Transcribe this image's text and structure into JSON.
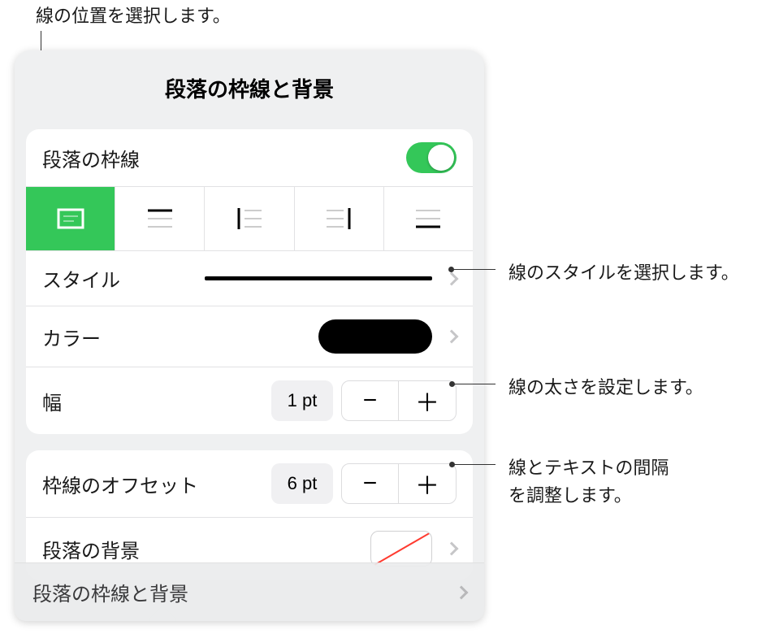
{
  "callouts": {
    "top": "線の位置を選択します。",
    "style": "線のスタイルを選択します。",
    "width": "線の太さを設定します。",
    "offset1": "線とテキストの間隔",
    "offset2": "を調整します。"
  },
  "panel": {
    "title": "段落の枠線と背景",
    "border_toggle_label": "段落の枠線",
    "style_label": "スタイル",
    "color_label": "カラー",
    "width_label": "幅",
    "width_value": "1 pt",
    "offset_label": "枠線のオフセット",
    "offset_value": "6 pt",
    "background_label": "段落の背景",
    "footer_label": "段落の枠線と背景"
  },
  "glyphs": {
    "minus": "−",
    "plus": "＋"
  }
}
